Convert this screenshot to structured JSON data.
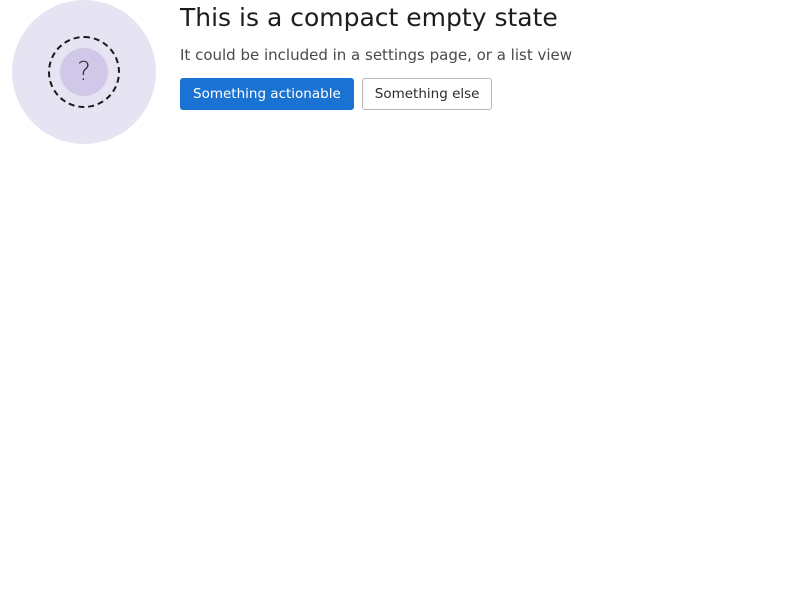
{
  "empty_state": {
    "icon": "question-mark-icon",
    "icon_glyph": "?",
    "title": "This is a compact empty state",
    "description": "It could be included in a settings page, or a list view",
    "primary_action": "Something actionable",
    "secondary_action": "Something else"
  },
  "colors": {
    "accent": "#1a73d3",
    "illustration_bg": "#e6e4f2",
    "illustration_disc": "#d1c7e8"
  }
}
